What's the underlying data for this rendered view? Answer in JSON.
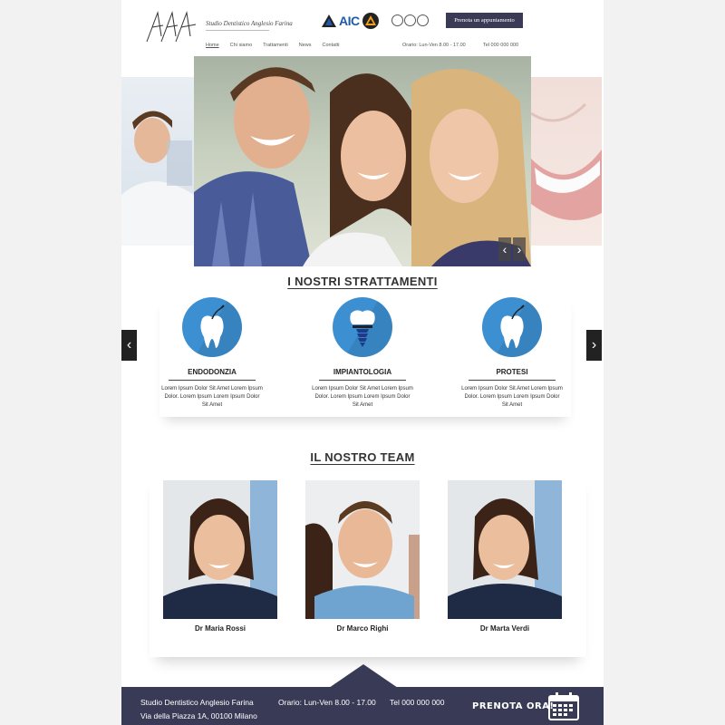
{
  "header": {
    "brand_name": "Studio Dentistico Anglesio Farina",
    "partner_logo_text": "AIC",
    "book_button": "Prenota un appuntamento",
    "nav": [
      "Home",
      "Chi siamo",
      "Trattamenti",
      "News",
      "Contatti"
    ],
    "hours": "Orario: Lun-Ven 8.00 - 17.00",
    "phone": "Tel 000 000 000"
  },
  "treatments": {
    "title": "I NOSTRI STRATTAMENTI",
    "items": [
      {
        "name": "ENDODONZIA",
        "desc": "Lorem Ipsum Dolor Sit Amet Lorem Ipsum Dolor. Lorem Ipsum Lorem Ipsum Dolor Sit Amet"
      },
      {
        "name": "IMPIANTOLOGIA",
        "desc": "Lorem Ipsum Dolor Sit Amet Lorem Ipsum Dolor. Lorem Ipsum Lorem Ipsum Dolor Sit Amet"
      },
      {
        "name": "PROTESI",
        "desc": "Lorem Ipsum Dolor Sit Amet Lorem Ipsum Dolor. Lorem Ipsum Lorem Ipsum Dolor Sit Amet"
      }
    ]
  },
  "team": {
    "title": "IL NOSTRO TEAM",
    "members": [
      {
        "name": "Dr Maria Rossi"
      },
      {
        "name": "Dr Marco Righi"
      },
      {
        "name": "Dr Marta Verdi"
      }
    ]
  },
  "footer": {
    "name": "Studio Dentistico Anglesio Farina",
    "address": "Via della Piazza 1A, 00100 Milano",
    "hours": "Orario: Lun-Ven 8.00 - 17.00",
    "phone": "Tel 000 000 000",
    "cta": "PRENOTA ORA!"
  },
  "colors": {
    "navy": "#393b56",
    "icon_blue": "#3c8fd0",
    "aic_blue": "#1f5aa6"
  },
  "icons": [
    "logo-icon",
    "aic-logo-icon",
    "social-circle-icon",
    "chevron-left-icon",
    "chevron-right-icon",
    "tooth-icon",
    "tooth-implant-icon",
    "calendar-icon"
  ]
}
